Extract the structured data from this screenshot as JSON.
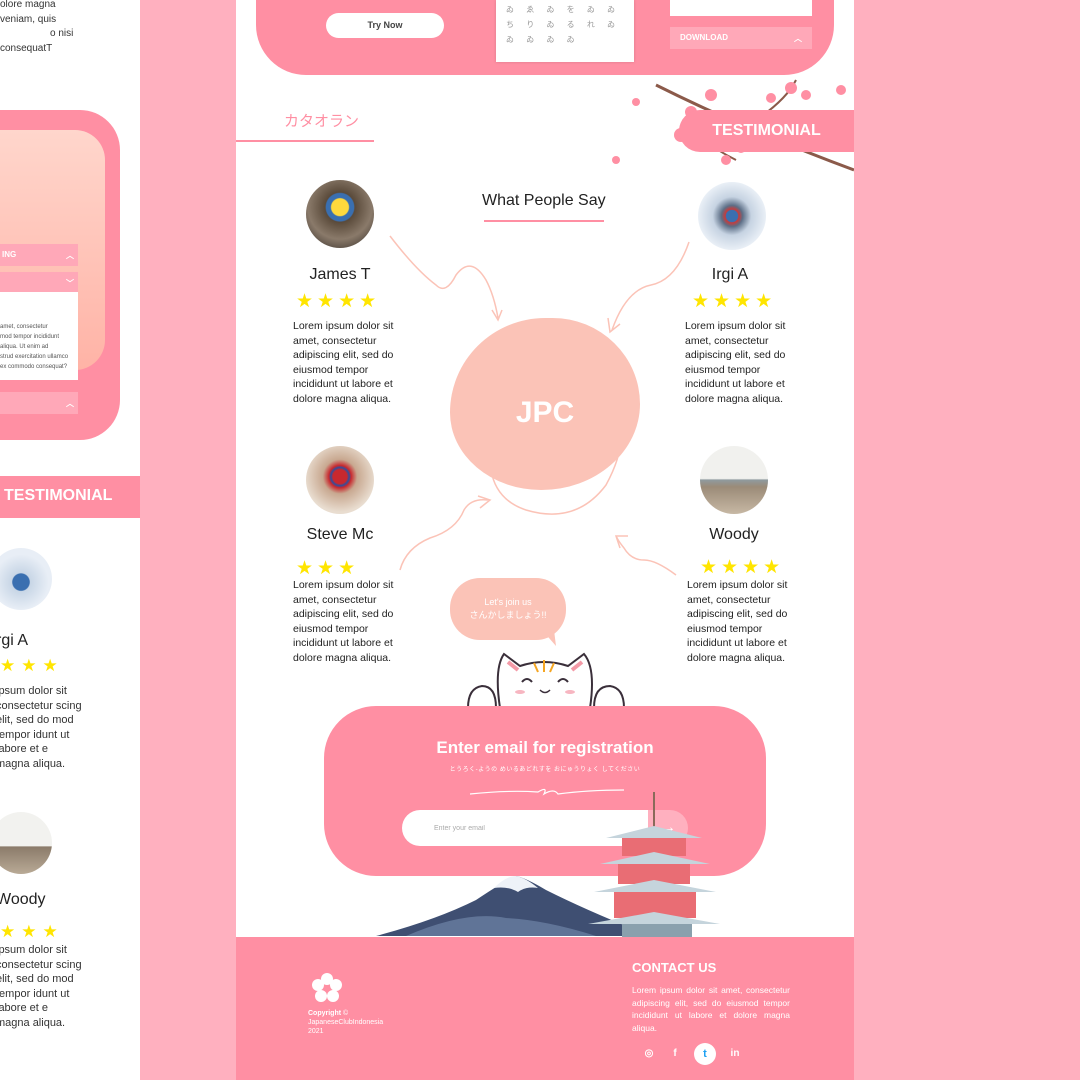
{
  "ghost": {
    "top_text": [
      "olore magna",
      "veniam, quis",
      "o nisi",
      "consequatT"
    ],
    "bar1": "ING",
    "panel_text": "amet, consectetur\nmod tempor incididunt\naliqua. Ut enim ad\nstrud exercitation ullamco\nex commodo consequat?",
    "testimonial": "TESTIMONIAL",
    "name1": "rgi A",
    "name2": "Woody",
    "text1": "ipsum dolor sit consectetur scing elit, sed do mod tempor idunt ut labore et e magna aliqua.",
    "text2": "ipsum dolor sit consectetur scing elit, sed do mod tempor idunt ut labore et e magna aliqua."
  },
  "hero": {
    "try_label": "Try Now",
    "download_label": "DOWNLOAD",
    "kana_rows": [
      "ゐ ゑ ゐ を ゐ ゐ",
      "ち り ゐ る れ ゐ",
      "ゐ   ゐ   ゐ   ゐ"
    ]
  },
  "section": {
    "katakana": "カタオラン",
    "tab": "TESTIMONIAL",
    "title": "What People Say",
    "center": "JPC"
  },
  "reviews": [
    {
      "name": "James T",
      "stars": "★★★★",
      "text": "Lorem ipsum dolor sit amet, consectetur adipiscing elit, sed do eiusmod tempor incididunt ut labore et dolore magna aliqua."
    },
    {
      "name": "Irgi A",
      "stars": "★★★★",
      "text": "Lorem ipsum dolor sit amet, consectetur adipiscing elit, sed do eiusmod tempor incididunt ut labore et dolore magna aliqua."
    },
    {
      "name": "Steve Mc",
      "stars": "★★★",
      "text": "Lorem ipsum dolor sit amet, consectetur adipiscing elit, sed do eiusmod tempor incididunt ut labore et dolore magna aliqua."
    },
    {
      "name": "Woody",
      "stars": "★★★★",
      "text": "Lorem ipsum dolor sit amet, consectetur adipiscing elit, sed do eiusmod tempor incididunt ut labore et dolore magna aliqua."
    }
  ],
  "bubble": {
    "line1": "Let's join us",
    "line2": "さんかしましょう!!"
  },
  "registration": {
    "title": "Enter email for registration",
    "subtitle": "とうろく-ようの めいるあどれすを おにゅうりょく してください",
    "placeholder": "Enter your email",
    "submit_icon": "→"
  },
  "footer": {
    "copyright_label": "Copyright",
    "copyright_org": "JapaneseClubIndonesia",
    "copyright_year": "2021",
    "contact_title": "CONTACT US",
    "contact_text": "Lorem ipsum dolor sit amet, consectetur adipiscing elit, sed do eiusmod tempor incididunt ut labore et dolore magna aliqua.",
    "socials": {
      "instagram": "◎",
      "facebook": "f",
      "twitter": "t",
      "linkedin": "in"
    }
  },
  "colors": {
    "brand_pink": "#ff8fa3",
    "peach": "#fbc3b7",
    "star": "#ffe500",
    "bg": "#ffb0bf"
  }
}
